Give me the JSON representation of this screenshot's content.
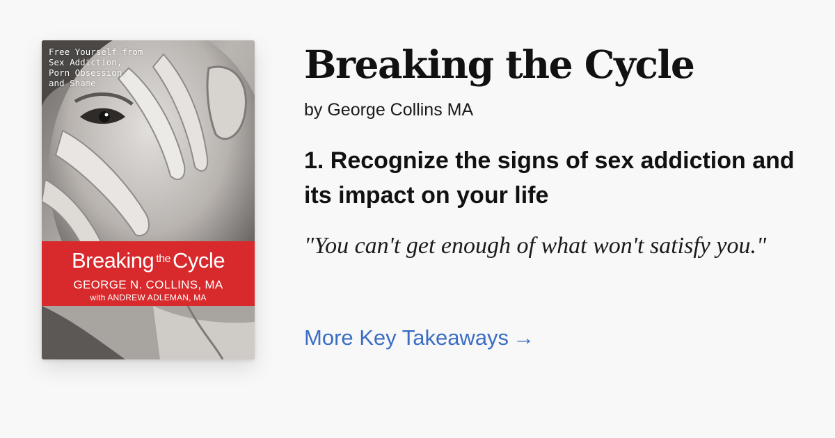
{
  "book": {
    "title": "Breaking the Cycle",
    "author": "by George Collins MA"
  },
  "cover": {
    "tagline": "Free Yourself from\nSex Addiction,\nPorn Obsession,\nand Shame",
    "title_left": "Breaking",
    "title_the": "the",
    "title_right": "Cycle",
    "author": "GEORGE N. COLLINS, MA",
    "coauthor": "with ANDREW ADLEMAN, MA",
    "band_color": "#d8292c"
  },
  "takeaway": {
    "text": "1. Recognize the signs of sex addiction and its impact on your life"
  },
  "quote": {
    "text": "\"You can't get enough of what won't satisfy you.\""
  },
  "link": {
    "label": "More Key Takeaways",
    "arrow": "→",
    "color": "#3a6dc4"
  }
}
